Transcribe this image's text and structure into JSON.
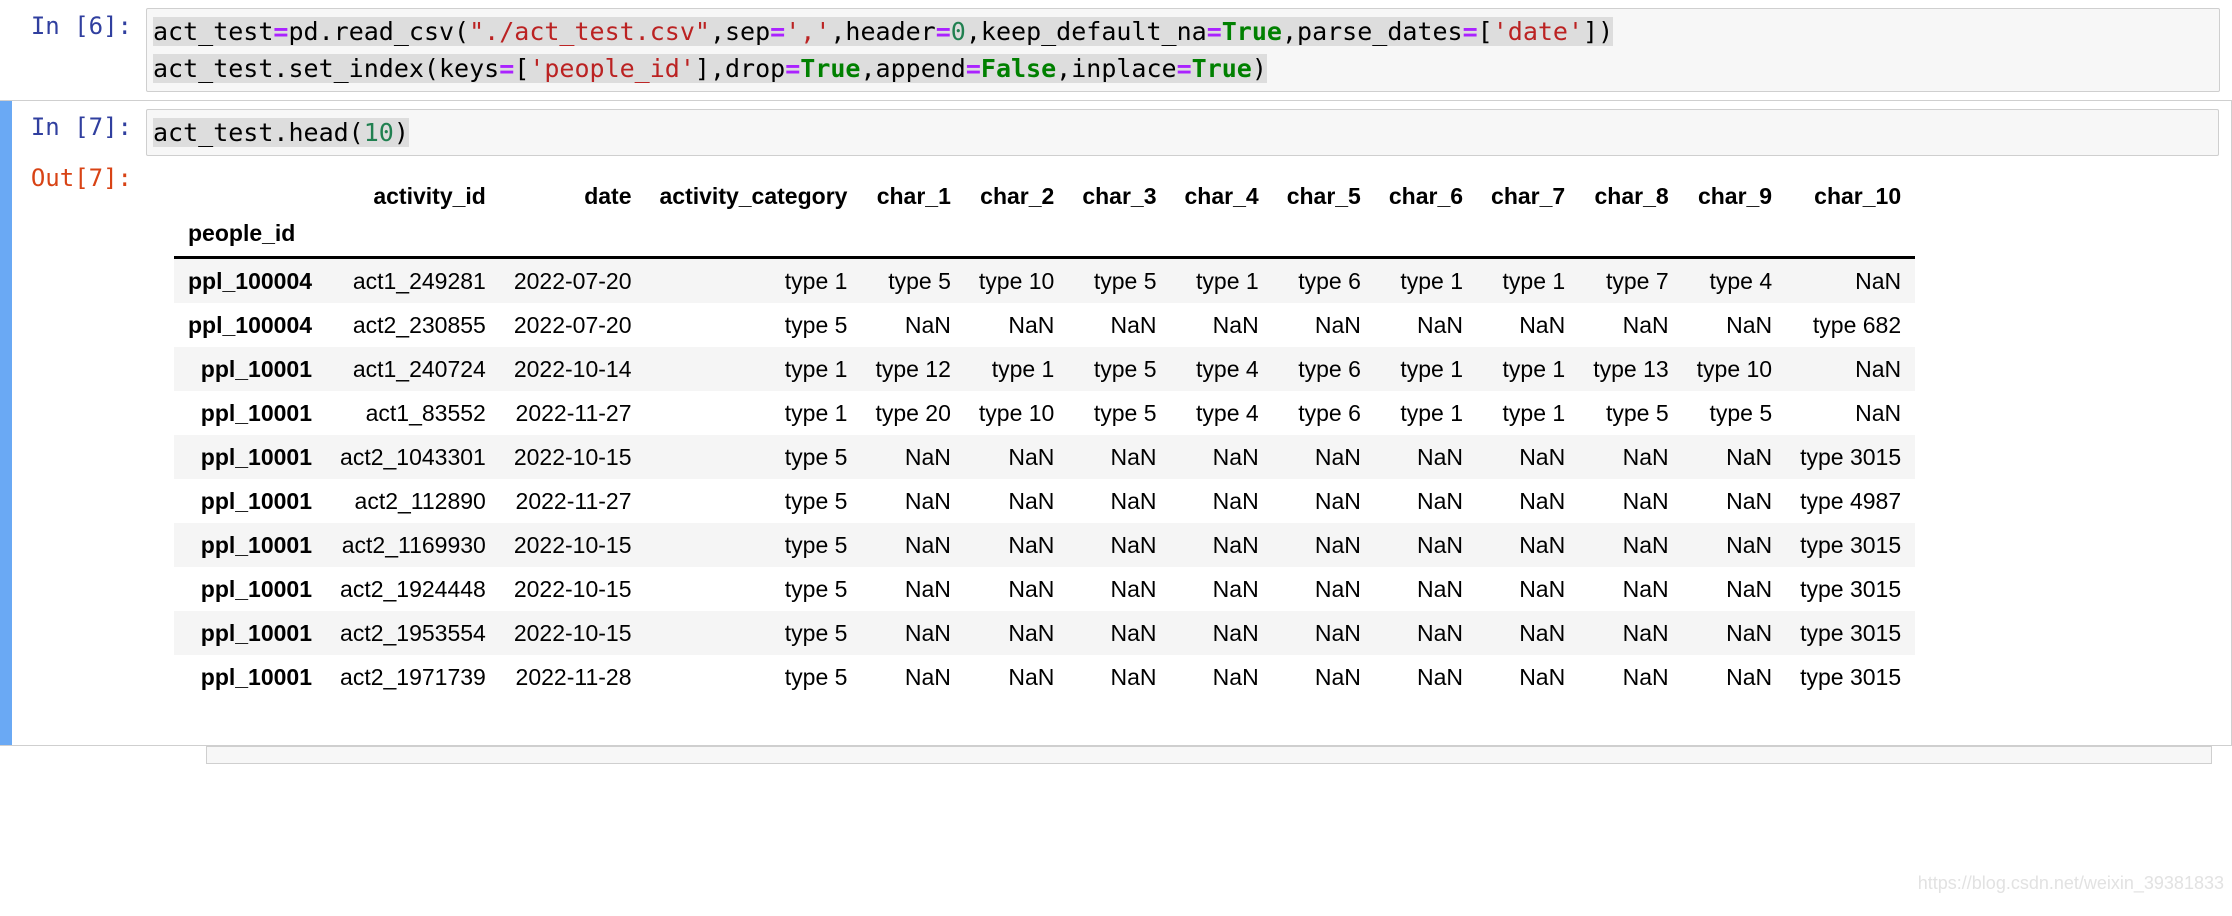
{
  "cells": [
    {
      "prompt": "In [6]:",
      "kind": "code",
      "selected": false,
      "lines": [
        [
          {
            "t": "act_test",
            "c": "pun"
          },
          {
            "t": "=",
            "c": "op"
          },
          {
            "t": "pd.read_csv(",
            "c": "pun"
          },
          {
            "t": "\"./act_test.csv\"",
            "c": "str"
          },
          {
            "t": ",sep",
            "c": "pun"
          },
          {
            "t": "=",
            "c": "op"
          },
          {
            "t": "','",
            "c": "str"
          },
          {
            "t": ",header",
            "c": "pun"
          },
          {
            "t": "=",
            "c": "op"
          },
          {
            "t": "0",
            "c": "num"
          },
          {
            "t": ",keep_default_na",
            "c": "pun"
          },
          {
            "t": "=",
            "c": "op"
          },
          {
            "t": "True",
            "c": "kw"
          },
          {
            "t": ",parse_dates",
            "c": "pun"
          },
          {
            "t": "=",
            "c": "op"
          },
          {
            "t": "[",
            "c": "pun"
          },
          {
            "t": "'date'",
            "c": "str"
          },
          {
            "t": "])",
            "c": "pun"
          }
        ],
        [
          {
            "t": "act_test.set_index(keys",
            "c": "pun"
          },
          {
            "t": "=",
            "c": "op"
          },
          {
            "t": "[",
            "c": "pun"
          },
          {
            "t": "'people_id'",
            "c": "str"
          },
          {
            "t": "],drop",
            "c": "pun"
          },
          {
            "t": "=",
            "c": "op"
          },
          {
            "t": "True",
            "c": "kw"
          },
          {
            "t": ",append",
            "c": "pun"
          },
          {
            "t": "=",
            "c": "op"
          },
          {
            "t": "False",
            "c": "kw"
          },
          {
            "t": ",inplace",
            "c": "pun"
          },
          {
            "t": "=",
            "c": "op"
          },
          {
            "t": "True",
            "c": "kw"
          },
          {
            "t": ")",
            "c": "pun"
          }
        ]
      ]
    },
    {
      "prompt": "In [7]:",
      "kind": "code",
      "selected": true,
      "lines": [
        [
          {
            "t": "act_test.head(",
            "c": "pun"
          },
          {
            "t": "10",
            "c": "num"
          },
          {
            "t": ")",
            "c": "pun"
          }
        ]
      ],
      "output_prompt": "Out[7]:"
    }
  ],
  "dataframe": {
    "index_name": "people_id",
    "columns": [
      "activity_id",
      "date",
      "activity_category",
      "char_1",
      "char_2",
      "char_3",
      "char_4",
      "char_5",
      "char_6",
      "char_7",
      "char_8",
      "char_9",
      "char_10"
    ],
    "index": [
      "ppl_100004",
      "ppl_100004",
      "ppl_10001",
      "ppl_10001",
      "ppl_10001",
      "ppl_10001",
      "ppl_10001",
      "ppl_10001",
      "ppl_10001",
      "ppl_10001"
    ],
    "rows": [
      [
        "act1_249281",
        "2022-07-20",
        "type 1",
        "type 5",
        "type 10",
        "type 5",
        "type 1",
        "type 6",
        "type 1",
        "type 1",
        "type 7",
        "type 4",
        "NaN"
      ],
      [
        "act2_230855",
        "2022-07-20",
        "type 5",
        "NaN",
        "NaN",
        "NaN",
        "NaN",
        "NaN",
        "NaN",
        "NaN",
        "NaN",
        "NaN",
        "type 682"
      ],
      [
        "act1_240724",
        "2022-10-14",
        "type 1",
        "type 12",
        "type 1",
        "type 5",
        "type 4",
        "type 6",
        "type 1",
        "type 1",
        "type 13",
        "type 10",
        "NaN"
      ],
      [
        "act1_83552",
        "2022-11-27",
        "type 1",
        "type 20",
        "type 10",
        "type 5",
        "type 4",
        "type 6",
        "type 1",
        "type 1",
        "type 5",
        "type 5",
        "NaN"
      ],
      [
        "act2_1043301",
        "2022-10-15",
        "type 5",
        "NaN",
        "NaN",
        "NaN",
        "NaN",
        "NaN",
        "NaN",
        "NaN",
        "NaN",
        "NaN",
        "type 3015"
      ],
      [
        "act2_112890",
        "2022-11-27",
        "type 5",
        "NaN",
        "NaN",
        "NaN",
        "NaN",
        "NaN",
        "NaN",
        "NaN",
        "NaN",
        "NaN",
        "type 4987"
      ],
      [
        "act2_1169930",
        "2022-10-15",
        "type 5",
        "NaN",
        "NaN",
        "NaN",
        "NaN",
        "NaN",
        "NaN",
        "NaN",
        "NaN",
        "NaN",
        "type 3015"
      ],
      [
        "act2_1924448",
        "2022-10-15",
        "type 5",
        "NaN",
        "NaN",
        "NaN",
        "NaN",
        "NaN",
        "NaN",
        "NaN",
        "NaN",
        "NaN",
        "type 3015"
      ],
      [
        "act2_1953554",
        "2022-10-15",
        "type 5",
        "NaN",
        "NaN",
        "NaN",
        "NaN",
        "NaN",
        "NaN",
        "NaN",
        "NaN",
        "NaN",
        "type 3015"
      ],
      [
        "act2_1971739",
        "2022-11-28",
        "type 5",
        "NaN",
        "NaN",
        "NaN",
        "NaN",
        "NaN",
        "NaN",
        "NaN",
        "NaN",
        "NaN",
        "type 3015"
      ]
    ]
  },
  "watermark": "https://blog.csdn.net/weixin_39381833",
  "colors": {
    "in_prompt": "#303f9f",
    "out_prompt": "#d84315",
    "selection_bar": "#6aa9f4",
    "code_bg": "#f7f7f7",
    "code_highlight": "#dddddd",
    "row_stripe": "#f5f5f5",
    "string_token": "#bb2222",
    "keyword_token": "#008000",
    "number_token": "#208050",
    "operator_token": "#aa22ff"
  }
}
